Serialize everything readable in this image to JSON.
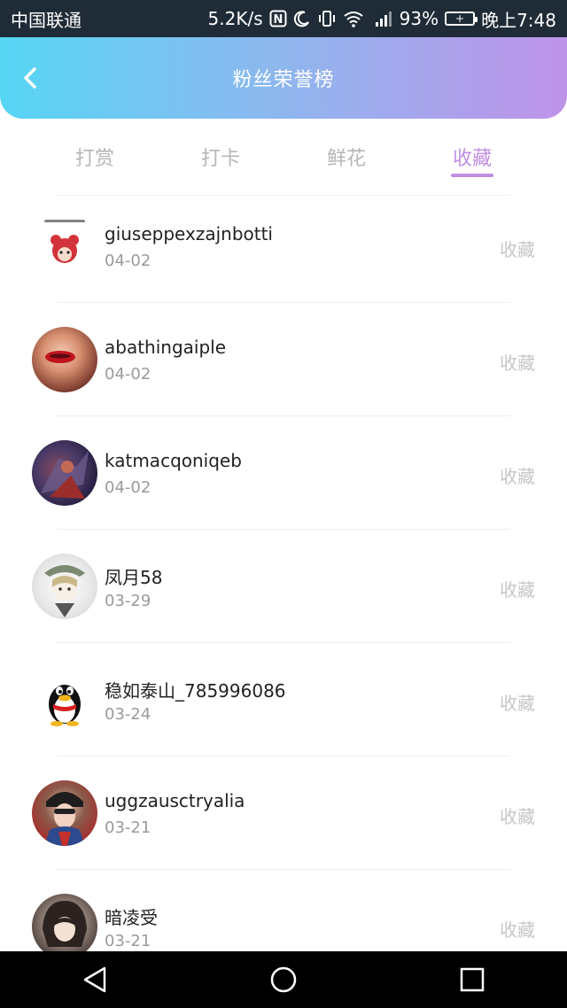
{
  "status_bar": {
    "carrier": "中国联通",
    "net_speed": "5.2K/s",
    "nfc_icon": "N",
    "battery_percent": "93%",
    "time": "晚上7:48"
  },
  "header": {
    "title": "粉丝荣誉榜",
    "back_icon": "chevron-left-icon"
  },
  "tabs": [
    {
      "label": "打赏",
      "active": false
    },
    {
      "label": "打卡",
      "active": false
    },
    {
      "label": "鲜花",
      "active": false
    },
    {
      "label": "收藏",
      "active": true
    }
  ],
  "list": [
    {
      "name": "giuseppexzajnbotti",
      "date": "04-02",
      "action": "收藏"
    },
    {
      "name": "abathingaiple",
      "date": "04-02",
      "action": "收藏"
    },
    {
      "name": "katmacqoniqeb",
      "date": "04-02",
      "action": "收藏"
    },
    {
      "name": "凤月58",
      "date": "03-29",
      "action": "收藏"
    },
    {
      "name": "稳如泰山_785996086",
      "date": "03-24",
      "action": "收藏"
    },
    {
      "name": "uggzausctryalia",
      "date": "03-21",
      "action": "收藏"
    },
    {
      "name": "暗凌受",
      "date": "03-21",
      "action": "收藏"
    }
  ],
  "colors": {
    "header_gradient_start": "#56d6f4",
    "header_gradient_end": "#bf93e8",
    "tab_active": "#c08ee2",
    "tab_inactive": "#b6b6b6",
    "action_text": "#c6c6c6"
  },
  "nav_bar": {
    "back": "triangle-back-icon",
    "home": "circle-home-icon",
    "recents": "square-recents-icon"
  }
}
